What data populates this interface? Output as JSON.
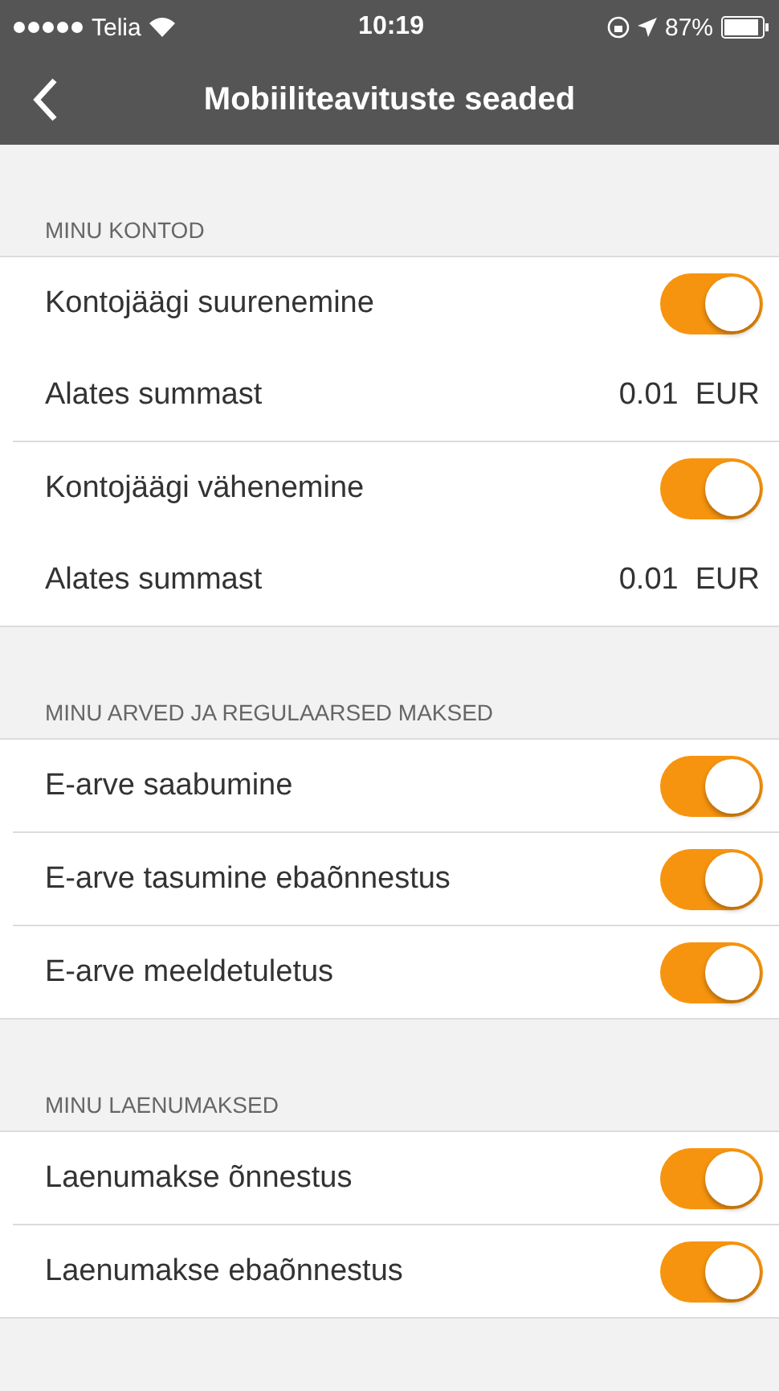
{
  "status_bar": {
    "carrier": "Telia",
    "time": "10:19",
    "battery": "87%"
  },
  "nav": {
    "title": "Mobiiliteavituste seaded"
  },
  "sections": [
    {
      "title": "MINU KONTOD",
      "settings": [
        {
          "label": "Kontojäägi suurenemine",
          "on": true,
          "threshold": {
            "label": "Alates summast",
            "value": "0.01  EUR"
          }
        },
        {
          "label": "Kontojäägi vähenemine",
          "on": true,
          "threshold": {
            "label": "Alates summast",
            "value": "0.01  EUR"
          }
        }
      ]
    },
    {
      "title": "MINU ARVED JA REGULAARSED MAKSED",
      "settings": [
        {
          "label": "E-arve saabumine",
          "on": true
        },
        {
          "label": "E-arve tasumine ebaõnnestus",
          "on": true
        },
        {
          "label": "E-arve meeldetuletus",
          "on": true
        }
      ]
    },
    {
      "title": "MINU LAENUMAKSED",
      "settings": [
        {
          "label": "Laenumakse õnnestus",
          "on": true
        },
        {
          "label": "Laenumakse ebaõnnestus",
          "on": true
        }
      ]
    }
  ]
}
